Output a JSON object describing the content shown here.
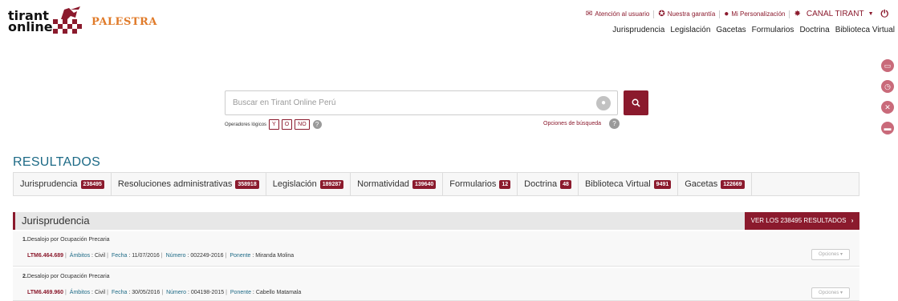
{
  "header": {
    "logo_text_1": "tirant",
    "logo_text_2": "online",
    "brand": "PALESTRA",
    "top_links": {
      "atencion": "Atención al usuario",
      "garantia": "Nuestra garantía",
      "personalizacion": "Mi Personalización",
      "canal": "CANAL TIRANT"
    },
    "nav": [
      "Jurisprudencia",
      "Legislación",
      "Gacetas",
      "Formularios",
      "Doctrina",
      "Biblioteca Virtual"
    ]
  },
  "search": {
    "placeholder": "Buscar en Tirant Online Perú",
    "operators_label": "Operadores lógicos",
    "operators": [
      "Y",
      "O",
      "NO"
    ],
    "options_label": "Opciones de búsqueda"
  },
  "results": {
    "title": "RESULTADOS",
    "tabs": [
      {
        "label": "Jurisprudencia",
        "count": "238495"
      },
      {
        "label": "Resoluciones administrativas",
        "count": "358918"
      },
      {
        "label": "Legislación",
        "count": "189287"
      },
      {
        "label": "Normatividad",
        "count": "139640"
      },
      {
        "label": "Formularios",
        "count": "12"
      },
      {
        "label": "Doctrina",
        "count": "48"
      },
      {
        "label": "Biblioteca Virtual",
        "count": "9491"
      },
      {
        "label": "Gacetas",
        "count": "122669"
      }
    ],
    "section_title": "Jurisprudencia",
    "view_all": "VER LOS 238495 RESULTADOS",
    "items": [
      {
        "num": "1.",
        "title": "Desalojo por Ocupación Precaria",
        "code": "LTM6.464.689",
        "ambitos_label": "Ámbitos",
        "ambitos": "Civil",
        "fecha_label": "Fecha",
        "fecha": "11/07/2016",
        "numero_label": "Número",
        "numero": "002249-2016",
        "ponente_label": "Ponente",
        "ponente": "Miranda Molina",
        "options": "Opciones"
      },
      {
        "num": "2.",
        "title": "Desalojo por Ocupación Precaria",
        "code": "LTM6.469.960",
        "ambitos_label": "Ámbitos",
        "ambitos": "Civil",
        "fecha_label": "Fecha",
        "fecha": "30/05/2016",
        "numero_label": "Número",
        "numero": "004198-2015",
        "ponente_label": "Ponente",
        "ponente": "Cabello Matamala",
        "options": "Opciones"
      }
    ]
  },
  "icons": {
    "mail": "mail-icon",
    "guarantee": "ribbon-icon",
    "user": "user-icon",
    "settings": "gear-icon",
    "dropdown": "caret-down-icon",
    "power": "power-icon",
    "search": "search-icon",
    "mic": "microphone-icon",
    "help": "question-icon"
  },
  "colors": {
    "brand": "#8b1a2d",
    "title_blue": "#1d6a86",
    "palestra": "#e07b2a"
  }
}
